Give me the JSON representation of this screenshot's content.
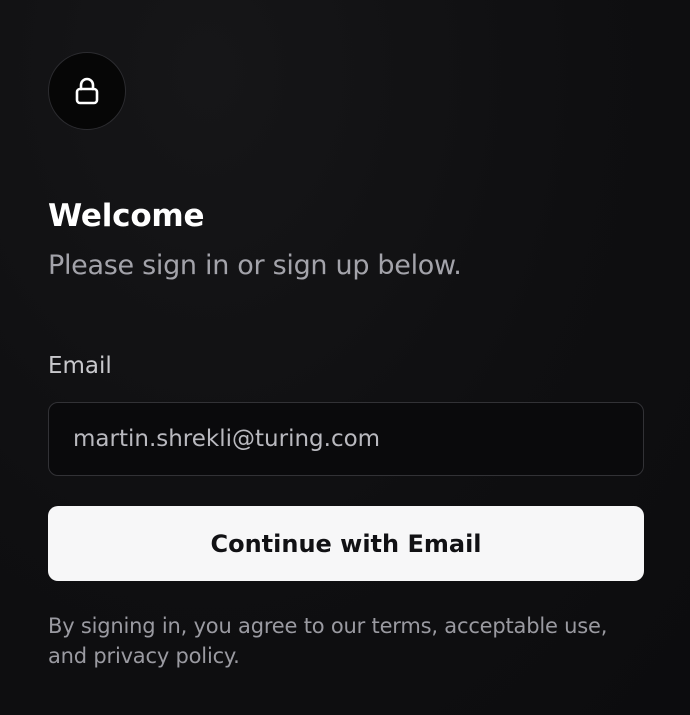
{
  "auth": {
    "icon": "lock-icon",
    "title": "Welcome",
    "subtitle": "Please sign in or sign up below.",
    "email": {
      "label": "Email",
      "value": "martin.shrekli@turing.com"
    },
    "continue_label": "Continue with Email",
    "legal_text": "By signing in, you agree to our terms, acceptable use, and privacy policy."
  },
  "colors": {
    "background": "#0e0e10",
    "button_bg": "#f7f7f8",
    "button_text": "#111114",
    "muted_text": "#a3a3aa",
    "input_border": "#323236"
  }
}
